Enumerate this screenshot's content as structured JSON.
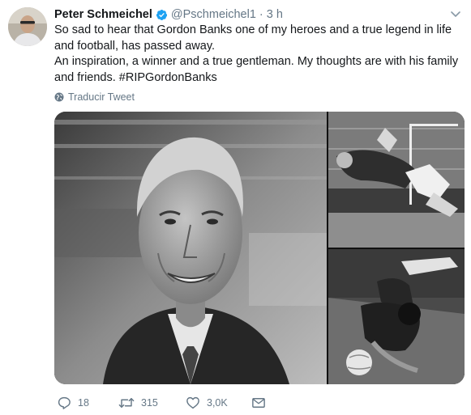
{
  "author": {
    "name": "Peter Schmeichel",
    "handle": "@Pschmeichel1",
    "separator": "·",
    "time": "3 h",
    "verified": true,
    "avatar_icon": "avatar-photo"
  },
  "tweet": {
    "line1": "So sad to hear that Gordon Banks one of my heroes and a true legend in life and football, has passed away.",
    "line2": "An inspiration, a winner and a true gentleman. My thoughts are with his family and friends. #RIPGordonBanks"
  },
  "translate_label": "Traducir Tweet",
  "actions": {
    "reply_count": "18",
    "retweet_count": "315",
    "like_count": "3,0K"
  },
  "colors": {
    "verified": "#1da1f2",
    "meta": "#657786",
    "text": "#14171a"
  }
}
